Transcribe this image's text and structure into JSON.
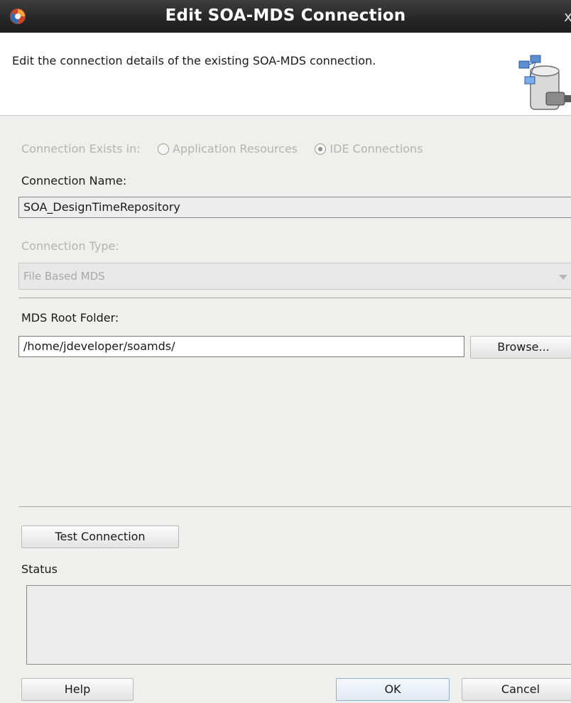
{
  "window": {
    "title": "Edit SOA-MDS Connection",
    "close_glyph": "x"
  },
  "header": {
    "description": "Edit the connection details of the existing SOA-MDS connection."
  },
  "connection_exists_in": {
    "label": "Connection Exists in:",
    "options": [
      {
        "label": "Application Resources",
        "selected": false
      },
      {
        "label": "IDE Connections",
        "selected": true
      }
    ]
  },
  "connection_name": {
    "label": "Connection Name:",
    "value": "SOA_DesignTimeRepository"
  },
  "connection_type": {
    "label": "Connection Type:",
    "value": "File Based MDS"
  },
  "mds_root": {
    "label": "MDS Root Folder:",
    "value": "/home/jdeveloper/soamds/",
    "browse_label": "Browse..."
  },
  "test": {
    "label": "Test Connection"
  },
  "status": {
    "label": "Status",
    "value": ""
  },
  "footer": {
    "help": "Help",
    "ok": "OK",
    "cancel": "Cancel"
  },
  "colors": {
    "titlebar": "#262626",
    "panel": "#efefee",
    "header_bg": "#ffffff",
    "disabled_text": "#b3b3b3"
  }
}
